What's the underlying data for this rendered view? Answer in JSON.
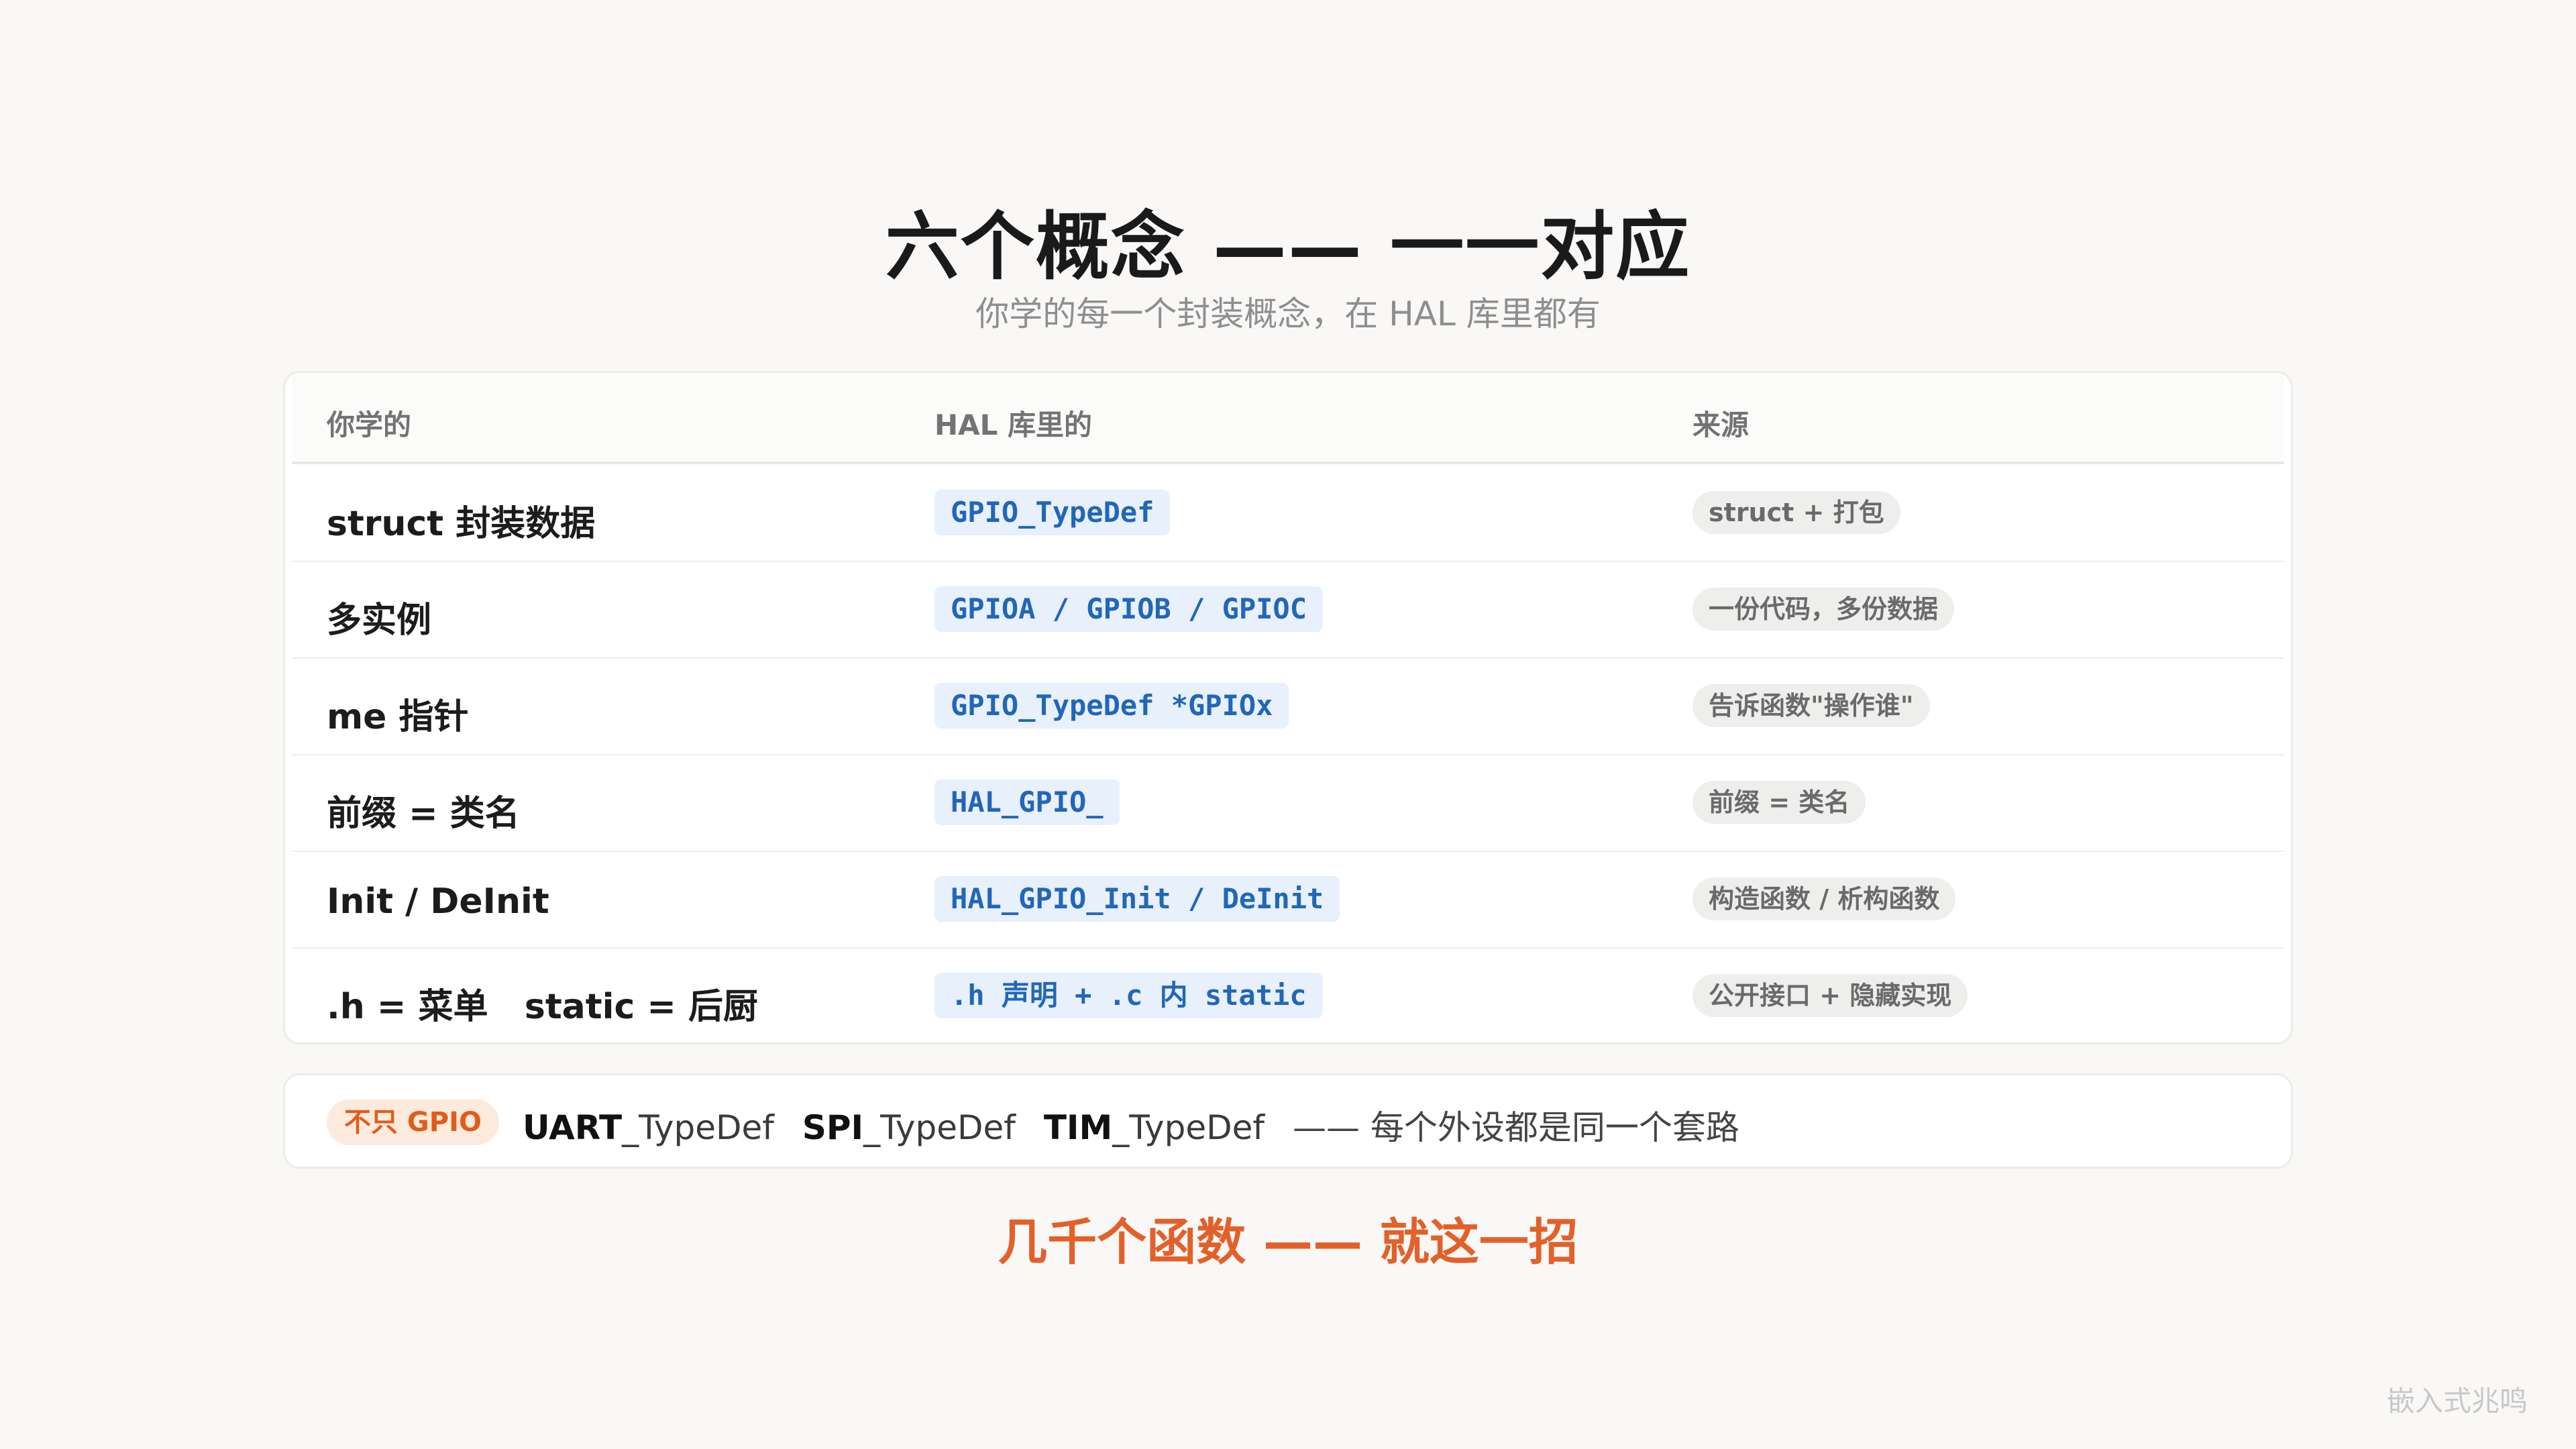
{
  "header": {
    "title": "六个概念 —— 一一对应",
    "subtitle": "你学的每一个封装概念，在 HAL 库里都有"
  },
  "table": {
    "columns": [
      "你学的",
      "HAL 库里的",
      "来源"
    ],
    "rows": [
      {
        "concept": "struct 封装数据",
        "hal": "GPIO_TypeDef",
        "source": "struct + 打包"
      },
      {
        "concept": "多实例",
        "hal": "GPIOA / GPIOB / GPIOC",
        "source": "一份代码，多份数据"
      },
      {
        "concept": "me 指针",
        "hal": "GPIO_TypeDef *GPIOx",
        "source": "告诉函数\"操作谁\""
      },
      {
        "concept": "前缀 = 类名",
        "hal": "HAL_GPIO_",
        "source": "前缀 = 类名"
      },
      {
        "concept": "Init / DeInit",
        "hal": "HAL_GPIO_Init / DeInit",
        "source": "构造函数 / 析构函数"
      },
      {
        "concept": ".h = 菜单   static = 后厨",
        "hal": ".h 声明 + .c 内 static",
        "source": "公开接口 + 隐藏实现"
      }
    ]
  },
  "note": {
    "badge": "不只 GPIO",
    "items": [
      {
        "prefix": "UART",
        "suffix": "_TypeDef"
      },
      {
        "prefix": "SPI",
        "suffix": "_TypeDef"
      },
      {
        "prefix": "TIM",
        "suffix": "_TypeDef"
      }
    ],
    "tail": "—— 每个外设都是同一个套路"
  },
  "tagline": "几千个函数 —— 就这一招",
  "watermark": "嵌入式兆鸣",
  "colors": {
    "accent": "#e3602a",
    "code_bg": "#e7f0fb",
    "code_text": "#2266b8",
    "background": "#f9f8f6"
  }
}
